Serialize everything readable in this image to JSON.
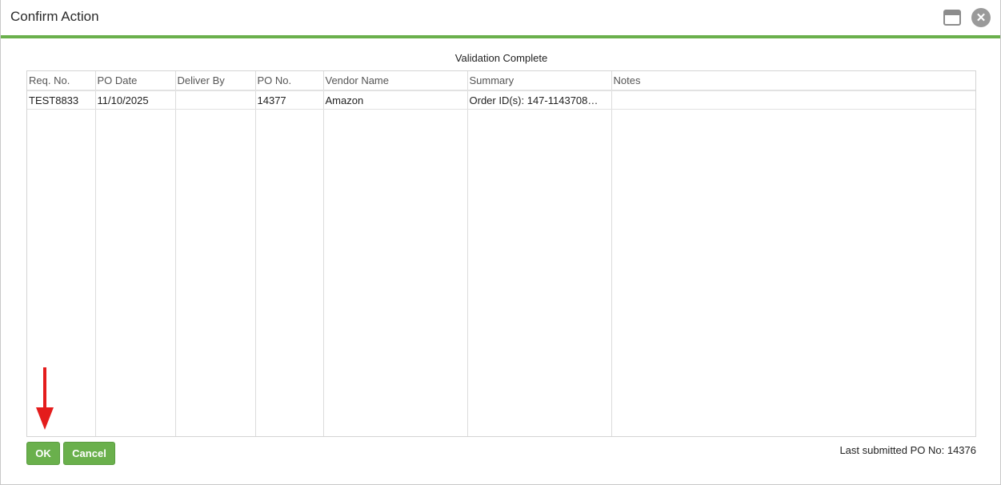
{
  "dialog": {
    "title": "Confirm Action",
    "maximize_icon": "maximize-icon",
    "close_icon": "close-icon",
    "close_glyph": "✕"
  },
  "status": "Validation Complete",
  "table": {
    "columns": [
      "Req. No.",
      "PO Date",
      "Deliver By",
      "PO No.",
      "Vendor Name",
      "Summary",
      "Notes"
    ],
    "rows": [
      [
        "TEST8833",
        "11/10/2025",
        "",
        "14377",
        "Amazon",
        "Order ID(s): 147-1143708…",
        ""
      ]
    ]
  },
  "buttons": {
    "ok": "OK",
    "cancel": "Cancel"
  },
  "footer": {
    "last_submitted": "Last submitted PO No: 14376"
  },
  "colors": {
    "accent": "#6ab04c",
    "annotation_arrow": "#e41c1c"
  }
}
